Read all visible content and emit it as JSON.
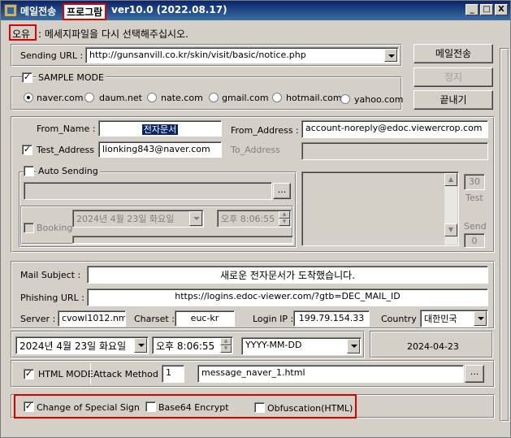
{
  "window": {
    "title_prefix": "메일전송",
    "title_highlight": "프로그람",
    "title_version": "ver10.0 (2022.08.17)",
    "min_symbol": "_",
    "max_symbol": "□",
    "close_symbol": "X"
  },
  "error": {
    "label": "오유",
    "message": ": 메세지파일을 다시 선택해주십시오."
  },
  "sending": {
    "label": "Sending URL  :",
    "url": "http://gunsanvill.co.kr/skin/visit/basic/notice.php"
  },
  "buttons": {
    "send": "메일전송",
    "stop": "정지",
    "exit": "끝내기"
  },
  "sample_mode": {
    "label": "SAMPLE MODE",
    "options": [
      "naver.com",
      "daum.net",
      "nate.com",
      "gmail.com",
      "hotmail.com",
      "yahoo.com"
    ],
    "selected": "naver.com"
  },
  "sender": {
    "from_name_label": "From_Name  :",
    "from_name_value": "전자문서",
    "from_address_label": "From_Address  :",
    "from_address_value": "account-noreply@edoc.viewercrop.com",
    "test_address_label": "Test_Address  :",
    "test_address_value": "lionking843@naver.com",
    "to_address_label": "To_Address"
  },
  "auto": {
    "label": "Auto Sending",
    "browse": "...",
    "booking_label": "Booking",
    "booking_date": "2024년   4월 23일 화요일",
    "booking_time": "오후   8:06:55",
    "test_count": "30",
    "test_label": "Test",
    "send_label": "Send",
    "send_count": "0"
  },
  "mail": {
    "subject_label": "Mail Subject  :",
    "subject_value": "새로운 전자문서가 도착했습니다.",
    "phishing_label": "Phishing URL  :",
    "phishing_value": "https://logins.edoc-viewer.com/?gtb=DEC_MAIL_ID",
    "server_label": "Server :",
    "server_value": "cvowl1012.nm",
    "charset_label": "Charset :",
    "charset_value": "euc-kr",
    "login_ip_label": "Login IP :",
    "login_ip_value": "199.79.154.33",
    "country_label": "Country :",
    "country_value": "대한민국"
  },
  "datetime": {
    "date": "2024년   4월 23일 화요일",
    "time": "오후   8:06:55",
    "format": "YYYY-MM-DD",
    "preview": "2024-04-23"
  },
  "html_mode": {
    "label": "HTML MODE",
    "attack_label": "Attack Method :",
    "attack_value": "1",
    "message_file": "message_naver_1.html",
    "browse": "..."
  },
  "options": {
    "special_sign": "Change of Special Sign",
    "base64": "Base64 Encrypt",
    "obfuscation": "Obfuscation(HTML)"
  },
  "glyphs": {
    "check": "✓",
    "up": "▲",
    "down": "▼"
  }
}
